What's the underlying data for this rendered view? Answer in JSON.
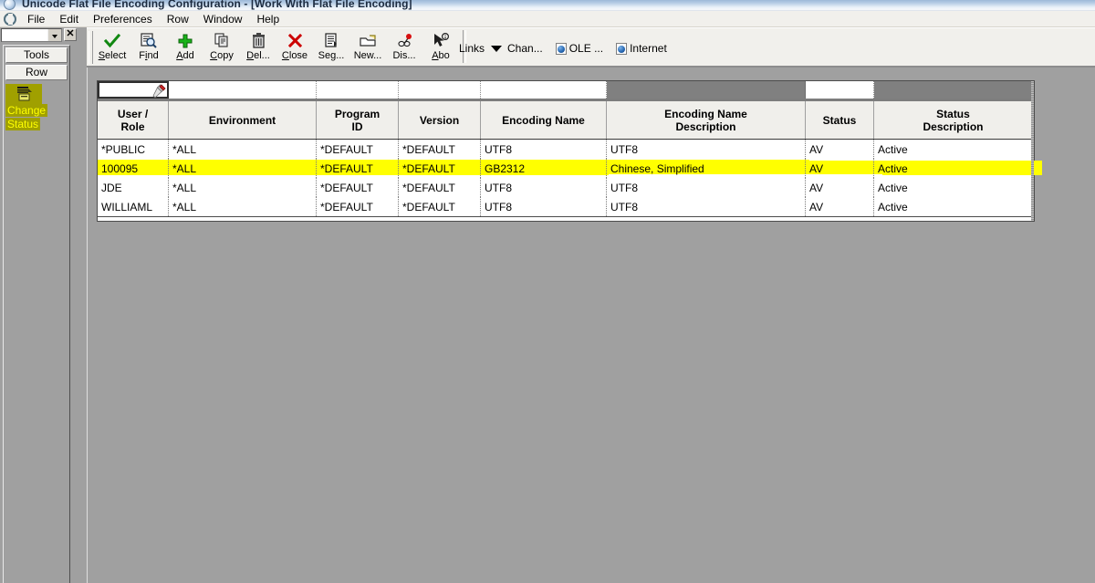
{
  "window": {
    "title": "Unicode Flat File Encoding Configuration - [Work With Flat File Encoding]",
    "logo_icon": "jde-globe-icon"
  },
  "menubar": {
    "app_icon": "application-globe-icon",
    "items": [
      {
        "label": "File"
      },
      {
        "label": "Edit"
      },
      {
        "label": "Preferences"
      },
      {
        "label": "Row"
      },
      {
        "label": "Window"
      },
      {
        "label": "Help"
      }
    ]
  },
  "toolbar": {
    "buttons": [
      {
        "label": "Select",
        "accel": "S",
        "icon": "checkmark-icon"
      },
      {
        "label": "Find",
        "accel": "i",
        "icon": "find-magnifier-icon"
      },
      {
        "label": "Add",
        "accel": "A",
        "icon": "plus-icon"
      },
      {
        "label": "Copy",
        "accel": "C",
        "icon": "copy-pages-icon"
      },
      {
        "label": "Del...",
        "accel": "D",
        "icon": "trash-can-icon"
      },
      {
        "label": "Close",
        "accel": "C",
        "icon": "red-x-icon"
      },
      {
        "label": "Seg...",
        "accel": "",
        "icon": "sequence-list-icon"
      },
      {
        "label": "New...",
        "accel": "",
        "icon": "new-folder-icon"
      },
      {
        "label": "Dis...",
        "accel": "",
        "icon": "display-pin-icon"
      },
      {
        "label": "Abo",
        "accel": "",
        "icon": "about-arrow-icon"
      }
    ],
    "links": {
      "label": "Links",
      "caret_icon": "dropdown-caret-icon",
      "items": [
        {
          "label": "Chan...",
          "icon": "none"
        },
        {
          "label": "OLE ...",
          "icon": "globe-page-icon"
        },
        {
          "label": "Internet",
          "icon": "globe-page-icon"
        }
      ]
    }
  },
  "leftpanel": {
    "combo_value": "",
    "combo_arrow_icon": "dropdown-caret-icon",
    "close_label": "✕",
    "buttons": [
      {
        "label": "Tools"
      },
      {
        "label": "Row"
      }
    ],
    "menu_item": {
      "icon": "change-status-icon",
      "line1": "Change",
      "line2": "Status",
      "bg_color": "#a0a000",
      "text_color": "#ffff00"
    }
  },
  "grid": {
    "qbe": {
      "torch_icon": "flashlight-torch-icon",
      "cells": [
        {
          "value": "",
          "state": "active"
        },
        {
          "value": "",
          "state": "enabled"
        },
        {
          "value": "",
          "state": "enabled"
        },
        {
          "value": "",
          "state": "enabled"
        },
        {
          "value": "",
          "state": "enabled"
        },
        {
          "value": "",
          "state": "disabled"
        },
        {
          "value": "",
          "state": "enabled"
        },
        {
          "value": "",
          "state": "disabled"
        }
      ]
    },
    "columns": [
      {
        "label": "User /\nRole",
        "line1": "User /",
        "line2": "Role"
      },
      {
        "label": "Environment",
        "line1": "Environment",
        "line2": ""
      },
      {
        "label": "Program ID",
        "line1": "Program",
        "line2": "ID"
      },
      {
        "label": "Version",
        "line1": "Version",
        "line2": ""
      },
      {
        "label": "Encoding Name",
        "line1": "Encoding Name",
        "line2": ""
      },
      {
        "label": "Encoding Name Description",
        "line1": "Encoding Name",
        "line2": "Description"
      },
      {
        "label": "Status",
        "line1": "Status",
        "line2": ""
      },
      {
        "label": "Status Description",
        "line1": "Status",
        "line2": "Description"
      }
    ],
    "rows": [
      {
        "highlighted": false,
        "cells": [
          "*PUBLIC",
          "*ALL",
          "*DEFAULT",
          "*DEFAULT",
          "UTF8",
          "UTF8",
          "AV",
          "Active"
        ]
      },
      {
        "highlighted": true,
        "cells": [
          "100095",
          "*ALL",
          "*DEFAULT",
          "*DEFAULT",
          "GB2312",
          "Chinese, Simplified",
          "AV",
          "Active"
        ]
      },
      {
        "highlighted": false,
        "cells": [
          "JDE",
          "*ALL",
          "*DEFAULT",
          "*DEFAULT",
          "UTF8",
          "UTF8",
          "AV",
          "Active"
        ]
      },
      {
        "highlighted": false,
        "cells": [
          "WILLIAML",
          "*ALL",
          "*DEFAULT",
          "*DEFAULT",
          "UTF8",
          "UTF8",
          "AV",
          "Active"
        ]
      }
    ],
    "highlight_color": "#ffff00"
  }
}
